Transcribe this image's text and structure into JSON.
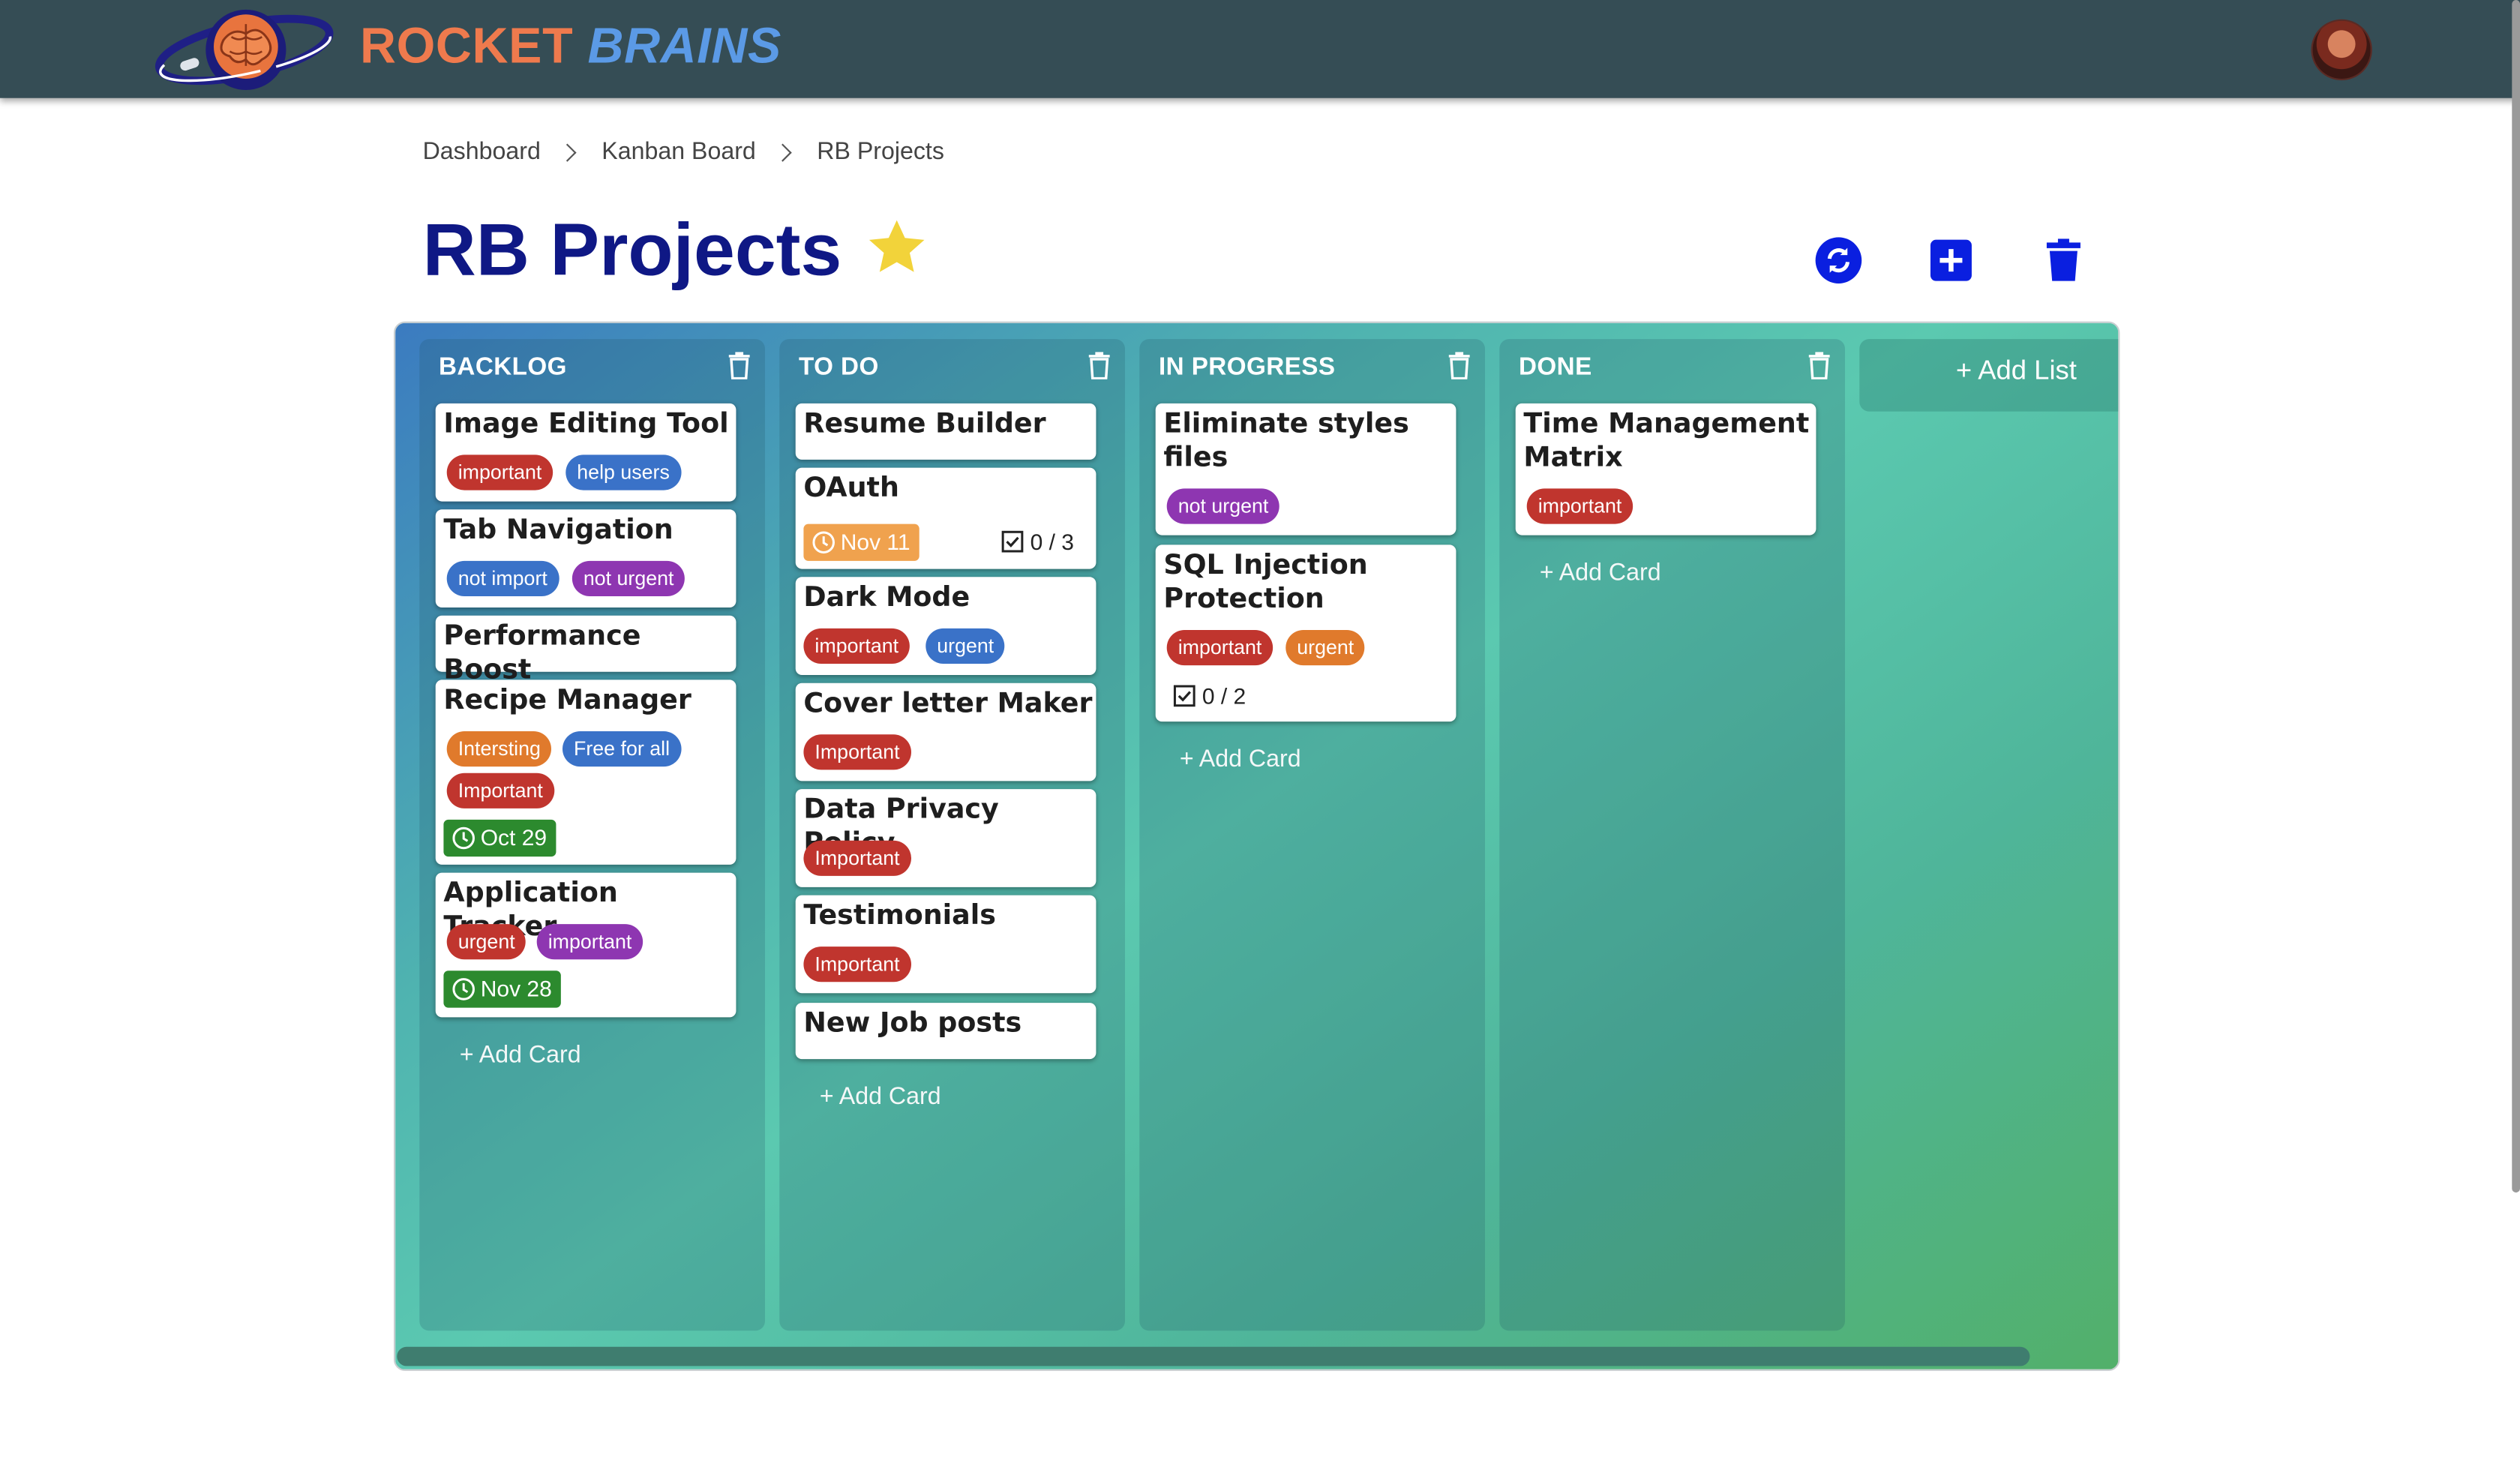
{
  "header": {
    "brand_word1": "ROCKET",
    "brand_word2": "BRAINS",
    "logo_icon": "rocket-brain-logo",
    "avatar_icon": "user-avatar"
  },
  "breadcrumb": [
    "Dashboard",
    "Kanban Board",
    "RB Projects"
  ],
  "page": {
    "title": "RB Projects",
    "favorite_icon": "star-icon",
    "actions": [
      "refresh-icon",
      "add-square-icon",
      "trash-icon"
    ]
  },
  "colors": {
    "header_bg": "#354d55",
    "title": "#0f1885",
    "action_blue": "#0a1fe0",
    "star": "#f2d33a",
    "tag_red": "#c0352e",
    "tag_blue": "#3a72c8",
    "tag_purple": "#8e36b1",
    "tag_orange": "#e07a2c",
    "due_green": "#2c8a2e",
    "due_amber": "#f0a24e"
  },
  "lists": [
    {
      "title": "BACKLOG",
      "add_card": "+ Add Card",
      "cards": [
        {
          "title": "Image Editing Tool",
          "tags": [
            "important",
            "help users"
          ]
        },
        {
          "title": "Tab Navigation",
          "tags": [
            "not import",
            "not urgent"
          ]
        },
        {
          "title": "Performance Boost",
          "tags": []
        },
        {
          "title": "Recipe Manager",
          "tags": [
            "Intersting",
            "Free for all",
            "Important"
          ],
          "due": "Oct 29"
        },
        {
          "title": "Application Tracker",
          "tags": [
            "urgent",
            "important"
          ],
          "due": "Nov 28"
        }
      ]
    },
    {
      "title": "TO DO",
      "add_card": "+ Add Card",
      "cards": [
        {
          "title": "Resume Builder",
          "tags": []
        },
        {
          "title": "OAuth",
          "tags": [],
          "due": "Nov 11",
          "checklist": "0 / 3"
        },
        {
          "title": "Dark Mode",
          "tags": [
            "important",
            "urgent"
          ]
        },
        {
          "title": "Cover letter Maker",
          "tags": [
            "Important"
          ]
        },
        {
          "title": "Data Privacy Policy",
          "tags": [
            "Important"
          ]
        },
        {
          "title": "Testimonials",
          "tags": [
            "Important"
          ]
        },
        {
          "title": "New Job posts",
          "tags": []
        }
      ]
    },
    {
      "title": "IN PROGRESS",
      "add_card": "+ Add Card",
      "cards": [
        {
          "title": "Eliminate styles files",
          "tags": [
            "not urgent"
          ]
        },
        {
          "title": "SQL Injection Protection",
          "tags": [
            "important",
            "urgent"
          ],
          "checklist": "0 / 2"
        }
      ]
    },
    {
      "title": "DONE",
      "add_card": "+ Add Card",
      "cards": [
        {
          "title": "Time Management Matrix",
          "tags": [
            "important"
          ]
        }
      ]
    }
  ],
  "add_list": "+ Add List"
}
